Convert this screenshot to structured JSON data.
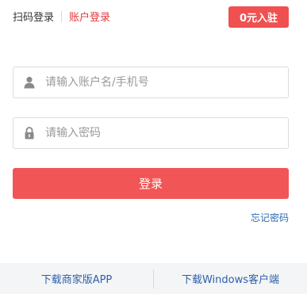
{
  "tabs": {
    "scan_login": "扫码登录",
    "account_login": "账户登录"
  },
  "join_button": "0元入驻",
  "username": {
    "icon": "user-icon",
    "placeholder": "请输入账户名/手机号",
    "value": ""
  },
  "password": {
    "icon": "lock-icon",
    "placeholder": "请输入密码",
    "value": ""
  },
  "login_button": "登录",
  "forgot_password": "忘记密码",
  "footer": {
    "download_app": "下载商家版APP",
    "download_windows": "下载Windows客户端"
  },
  "colors": {
    "accent": "#f25555",
    "active_tab": "#e4393c",
    "link": "#2b6cb0"
  }
}
